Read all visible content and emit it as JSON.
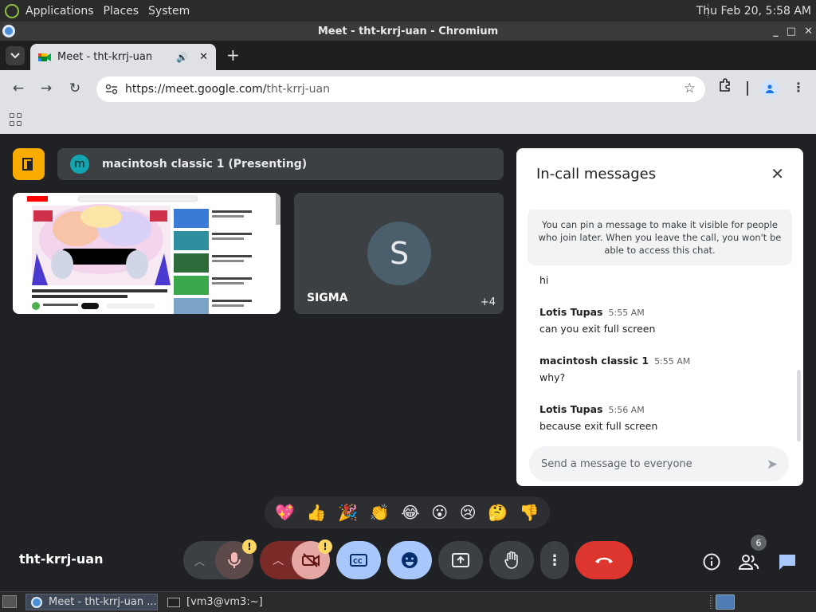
{
  "panel": {
    "applications": "Applications",
    "places": "Places",
    "system": "System",
    "clock": "Thu Feb 20,  5:58 AM"
  },
  "window": {
    "title": "Meet - tht-krrj-uan - Chromium",
    "controls": [
      "_",
      "□",
      "✕"
    ]
  },
  "tab": {
    "title": "Meet - tht-krrj-uan",
    "new_tab": "+"
  },
  "omnibox": {
    "url_host": "https://meet.google.com/",
    "url_path": "tht-krrj-uan"
  },
  "meet": {
    "presenting": {
      "avatar_letter": "m",
      "label": "macintosh classic 1 (Presenting)"
    },
    "participant_tile": {
      "avatar_letter": "S",
      "name": "SIGMA",
      "more": "+4"
    },
    "meeting_code": "tht-krrj-uan",
    "people_count": "6",
    "reactions": [
      "💖",
      "👍",
      "🎉",
      "👏",
      "😂",
      "😮",
      "😢",
      "🤔",
      "👎"
    ],
    "warn_mark": "!"
  },
  "chat": {
    "title": "In-call messages",
    "note": "You can pin a message to make it visible for people who join later. When you leave the call, you won't be able to access this chat.",
    "messages": [
      {
        "sender": "",
        "time": "",
        "text": "hi"
      },
      {
        "sender": "Lotis Tupas",
        "time": "5:55 AM",
        "text": "can you exit full screen"
      },
      {
        "sender": "macintosh classic 1",
        "time": "5:55 AM",
        "text": "why?"
      },
      {
        "sender": "Lotis Tupas",
        "time": "5:56 AM",
        "text": "because exit full screen"
      }
    ],
    "input_placeholder": "Send a message to everyone"
  },
  "taskbar": {
    "meet_window": "Meet - tht-krrj-uan ...",
    "terminal_window": "[vm3@vm3:~]"
  },
  "colors": {
    "end_call": "#dc362e",
    "present_accent": "#f9ab00",
    "active_control": "#a8c7fa"
  }
}
